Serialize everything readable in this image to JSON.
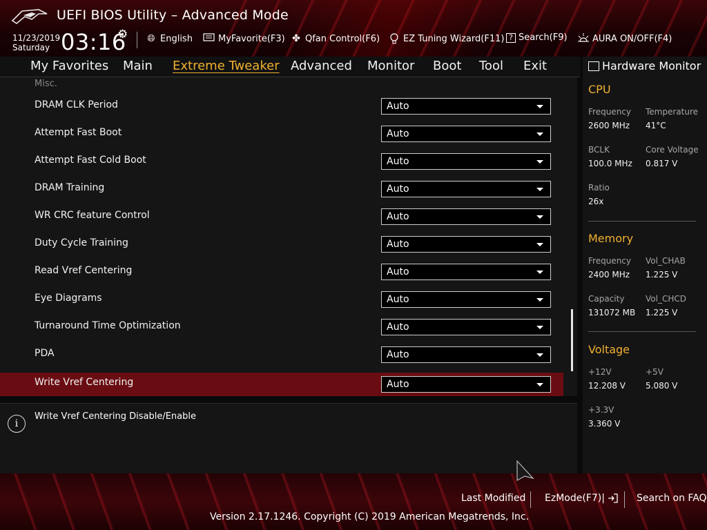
{
  "header": {
    "title": "UEFI BIOS Utility – Advanced Mode",
    "date": "11/23/2019",
    "weekday": "Saturday",
    "time": "03:16",
    "buttons": {
      "language": "English",
      "myfavorite": "MyFavorite(F3)",
      "qfan": "Qfan Control(F6)",
      "ez_tuning": "EZ Tuning Wizard(F11)",
      "search": "Search(F9)",
      "aura": "AURA ON/OFF(F4)"
    }
  },
  "nav": {
    "tabs": [
      "My Favorites",
      "Main",
      "Extreme Tweaker",
      "Advanced",
      "Monitor",
      "Boot",
      "Tool",
      "Exit"
    ],
    "active": "Extreme Tweaker"
  },
  "main": {
    "section": "Misc.",
    "rows": [
      {
        "label": "DRAM CLK Period",
        "value": "Auto"
      },
      {
        "label": "Attempt Fast Boot",
        "value": "Auto"
      },
      {
        "label": "Attempt Fast Cold Boot",
        "value": "Auto"
      },
      {
        "label": "DRAM Training",
        "value": "Auto"
      },
      {
        "label": "WR CRC feature Control",
        "value": "Auto"
      },
      {
        "label": "Duty Cycle Training",
        "value": "Auto"
      },
      {
        "label": "Read Vref Centering",
        "value": "Auto"
      },
      {
        "label": "Eye Diagrams",
        "value": "Auto"
      },
      {
        "label": "Turnaround Time Optimization",
        "value": "Auto"
      },
      {
        "label": "PDA",
        "value": "Auto"
      },
      {
        "label": "Write Vref Centering",
        "value": "Auto"
      }
    ],
    "selected_index": 10
  },
  "help": {
    "text": "Write Vref Centering Disable/Enable"
  },
  "hwmon": {
    "title": "Hardware Monitor",
    "cpu": {
      "heading": "CPU",
      "frequency_label": "Frequency",
      "frequency": "2600 MHz",
      "temperature_label": "Temperature",
      "temperature": "41°C",
      "bclk_label": "BCLK",
      "bclk": "100.0 MHz",
      "core_voltage_label": "Core Voltage",
      "core_voltage": "0.817 V",
      "ratio_label": "Ratio",
      "ratio": "26x"
    },
    "memory": {
      "heading": "Memory",
      "frequency_label": "Frequency",
      "frequency": "2400 MHz",
      "vol_chab_label": "Vol_CHAB",
      "vol_chab": "1.225 V",
      "capacity_label": "Capacity",
      "capacity": "131072 MB",
      "vol_chcd_label": "Vol_CHCD",
      "vol_chcd": "1.225 V"
    },
    "voltage": {
      "heading": "Voltage",
      "v12_label": "+12V",
      "v12": "12.208 V",
      "v5_label": "+5V",
      "v5": "5.080 V",
      "v33_label": "+3.3V",
      "v33": "3.360 V"
    }
  },
  "footer": {
    "last_modified": "Last Modified",
    "ezmode": "EzMode(F7)|",
    "search_faq": "Search on FAQ",
    "copyright": "Version 2.17.1246. Copyright (C) 2019 American Megatrends, Inc."
  },
  "colors": {
    "accent": "#f0b030",
    "selected_row": "#6a0d12",
    "brand_red": "#c8141e"
  }
}
